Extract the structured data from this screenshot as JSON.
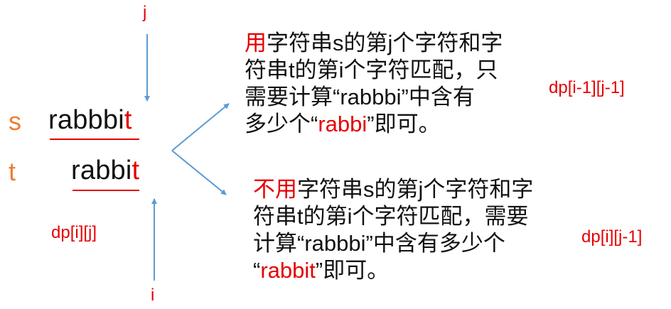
{
  "labels": {
    "j": "j",
    "i": "i",
    "s": "s",
    "t": "t"
  },
  "strings": {
    "s_main": "rabbbi",
    "s_last": "t",
    "t_main": "rabbi",
    "t_last": "t"
  },
  "dp": {
    "current": "dp[i][j]",
    "use": "dp[i-1][j-1]",
    "skip": "dp[i][j-1]"
  },
  "case_use": {
    "line1_prefix": "用",
    "line1_rest": "字符串s的第j个字符和字",
    "line2": "符串t的第i个字符匹配，只",
    "line3": "需要计算“rabbbi”中含有",
    "line4_a": "多少个“",
    "line4_b": "rabbi",
    "line4_c": "”即可。"
  },
  "case_skip": {
    "line1_prefix": "不用",
    "line1_rest": "字符串s的第j个字符和字",
    "line2": "符串t的第i个字符匹配，需要",
    "line3": "计算“rabbbi”中含有多少个",
    "line4_a": "“",
    "line4_b": "rabbit",
    "line4_c": "”即可。"
  },
  "colors": {
    "highlight": "#e60000",
    "label": "#ed7d31",
    "arrow": "#5b9bd5",
    "text": "#111111"
  }
}
